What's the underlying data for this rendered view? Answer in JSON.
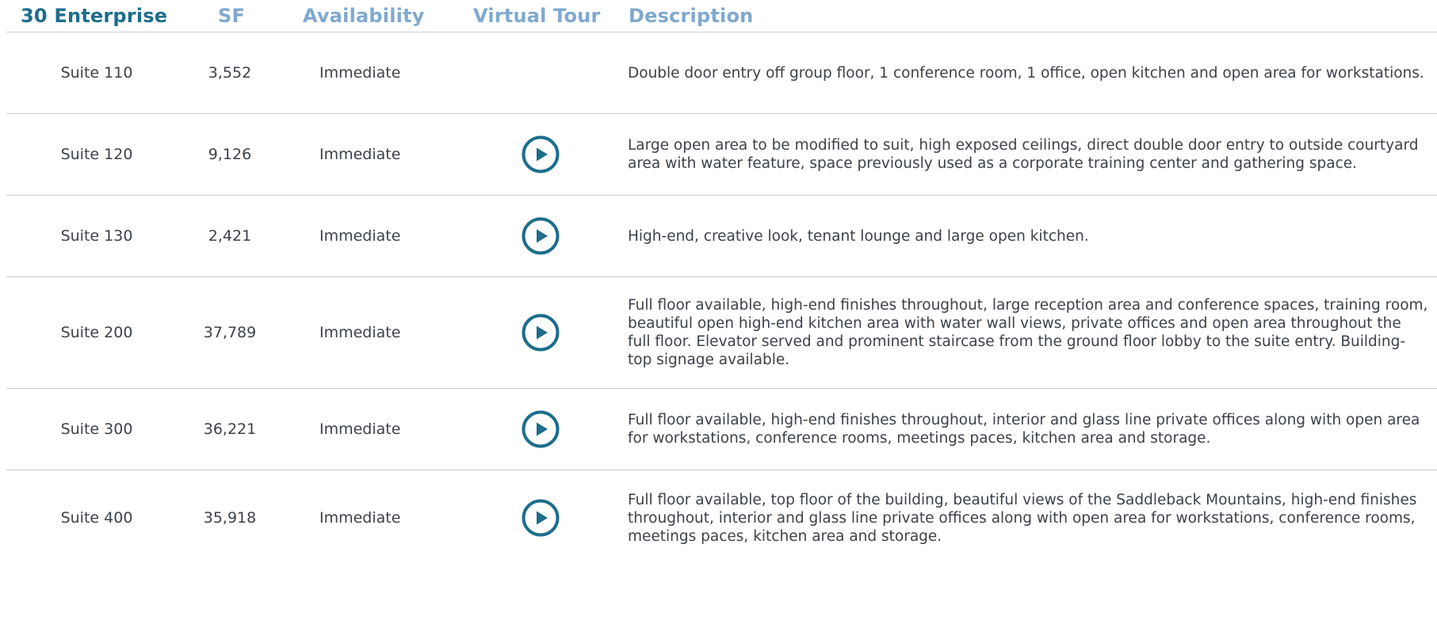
{
  "header": {
    "building": "30 Enterprise",
    "sf": "SF",
    "availability": "Availability",
    "virtual_tour": "Virtual Tour",
    "description": "Description"
  },
  "colors": {
    "building_heading": "#1d6d8c",
    "column_heading": "#7fa9cf",
    "play_icon": "#1d6d8c",
    "divider": "#c9ced3"
  },
  "rows": [
    {
      "suite": "Suite 110",
      "sf": "3,552",
      "availability": "Immediate",
      "has_tour": false,
      "description": "Double door entry off group floor, 1 conference room, 1 office, open kitchen and open area for workstations."
    },
    {
      "suite": "Suite 120",
      "sf": "9,126",
      "availability": "Immediate",
      "has_tour": true,
      "tour_icon": "play-circle-icon",
      "description": "Large open area to be modified to suit, high exposed ceilings, direct double door entry to outside courtyard area with water feature, space previously used as a corporate training center and gathering space."
    },
    {
      "suite": "Suite 130",
      "sf": "2,421",
      "availability": "Immediate",
      "has_tour": true,
      "tour_icon": "play-circle-icon",
      "description": "High-end, creative look, tenant lounge and large open kitchen."
    },
    {
      "suite": "Suite 200",
      "sf": "37,789",
      "availability": "Immediate",
      "has_tour": true,
      "tour_icon": "play-circle-icon",
      "description": "Full floor available, high-end finishes throughout, large reception area and conference spaces, training room, beautiful open high-end kitchen area with water wall views, private offices and  open area throughout the full floor. Elevator served and prominent staircase from the ground floor lobby to the suite entry. Building-top signage available."
    },
    {
      "suite": "Suite 300",
      "sf": "36,221",
      "availability": "Immediate",
      "has_tour": true,
      "tour_icon": "play-circle-icon",
      "description": "Full floor available, high-end finishes throughout, interior and glass line private offices along with open area for workstations, conference rooms, meetings paces, kitchen area and storage."
    },
    {
      "suite": "Suite 400",
      "sf": "35,918",
      "availability": "Immediate",
      "has_tour": true,
      "tour_icon": "play-circle-icon",
      "description": "Full floor available, top floor of the building, beautiful views of the Saddleback Mountains, high-end finishes throughout, interior and glass line private offices along with open area for workstations, conference rooms, meetings paces, kitchen area and storage."
    }
  ]
}
